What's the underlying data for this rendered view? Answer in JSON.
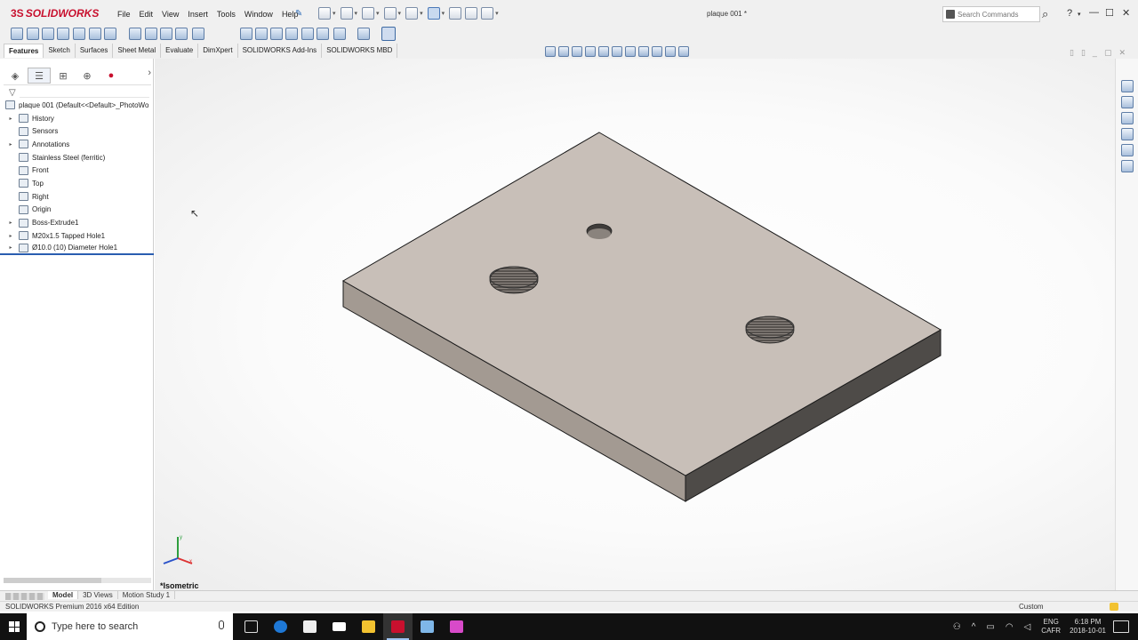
{
  "app": {
    "logo_text": "SOLIDWORKS",
    "logo_mark": "3S",
    "document_title": "plaque 001 *"
  },
  "menu": [
    "File",
    "Edit",
    "View",
    "Insert",
    "Tools",
    "Window",
    "Help"
  ],
  "search": {
    "placeholder": "Search Commands"
  },
  "command_tabs": [
    {
      "label": "Features",
      "active": true
    },
    {
      "label": "Sketch",
      "active": false
    },
    {
      "label": "Surfaces",
      "active": false
    },
    {
      "label": "Sheet Metal",
      "active": false
    },
    {
      "label": "Evaluate",
      "active": false
    },
    {
      "label": "DimXpert",
      "active": false
    },
    {
      "label": "SOLIDWORKS Add-Ins",
      "active": false
    },
    {
      "label": "SOLIDWORKS MBD",
      "active": false
    }
  ],
  "feature_tree": {
    "root": "plaque 001  (Default<<Default>_PhotoWo",
    "items": [
      {
        "label": "History",
        "expandable": true,
        "icon": "history-folder-icon"
      },
      {
        "label": "Sensors",
        "expandable": false,
        "icon": "sensors-icon"
      },
      {
        "label": "Annotations",
        "expandable": true,
        "icon": "annotations-icon"
      },
      {
        "label": "Stainless Steel (ferritic)",
        "expandable": false,
        "icon": "material-icon"
      },
      {
        "label": "Front",
        "expandable": false,
        "icon": "plane-icon"
      },
      {
        "label": "Top",
        "expandable": false,
        "icon": "plane-icon"
      },
      {
        "label": "Right",
        "expandable": false,
        "icon": "plane-icon"
      },
      {
        "label": "Origin",
        "expandable": false,
        "icon": "origin-icon"
      },
      {
        "label": "Boss-Extrude1",
        "expandable": true,
        "icon": "extrude-icon"
      },
      {
        "label": "M20x1.5 Tapped Hole1",
        "expandable": true,
        "icon": "hole-wizard-icon"
      },
      {
        "label": "Ø10.0 (10) Diameter Hole1",
        "expandable": true,
        "icon": "hole-wizard-icon"
      }
    ]
  },
  "viewport": {
    "view_name": "*Isometric"
  },
  "bottom_tabs": [
    {
      "label": "Model",
      "active": true
    },
    {
      "label": "3D Views",
      "active": false
    },
    {
      "label": "Motion Study 1",
      "active": false
    }
  ],
  "status": {
    "edition": "SOLIDWORKS Premium 2016 x64 Edition",
    "units": "Custom"
  },
  "taskbar": {
    "search_placeholder": "Type here to search",
    "lang_line1": "ENG",
    "lang_line2": "CAFR",
    "time": "6:18 PM",
    "date": "2018-10-01"
  },
  "colors": {
    "plate_top": "#c8bfb8",
    "plate_left": "#a39a92",
    "plate_right": "#4e4b48",
    "brand_red": "#c8102e",
    "selection_blue": "#2a5db0"
  }
}
